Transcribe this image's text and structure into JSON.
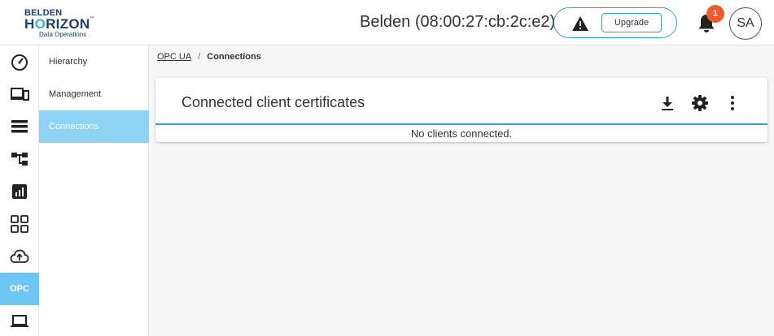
{
  "app": {
    "logo_line1": "BELDEN",
    "logo_line2a": "H",
    "logo_line2o": "O",
    "logo_line2b": "RIZON",
    "logo_tm": "™",
    "logo_line3": "Data Operations"
  },
  "header": {
    "device_title": "Belden (08:00:27:cb:2c:e2)",
    "upgrade_label": "Upgrade",
    "notification_count": "1",
    "avatar_initials": "SA"
  },
  "rail": {
    "items": [
      {
        "icon": "dashboard-gauge-icon"
      },
      {
        "icon": "devices-icon"
      },
      {
        "icon": "list-icon"
      },
      {
        "icon": "hierarchy-tree-icon"
      },
      {
        "icon": "bar-chart-icon"
      },
      {
        "icon": "apps-grid-icon"
      },
      {
        "icon": "cloud-upload-icon"
      },
      {
        "icon": "opc-icon",
        "label": "OPC",
        "active": true
      },
      {
        "icon": "laptop-icon"
      }
    ]
  },
  "subnav": {
    "items": [
      {
        "label": "Hierarchy"
      },
      {
        "label": "Management"
      },
      {
        "label": "Connections",
        "active": true
      }
    ]
  },
  "breadcrumb": {
    "parent": "OPC UA",
    "separator": "/",
    "current": "Connections"
  },
  "card": {
    "title": "Connected client certificates",
    "empty_message": "No clients connected.",
    "tools": [
      "download-icon",
      "settings-gear-icon",
      "more-vertical-icon"
    ]
  },
  "colors": {
    "accent": "#2aa7cf",
    "rail_active": "#6ec7f2",
    "subnav_active": "#8fd3f4",
    "badge": "#f15a2b",
    "brand_navy": "#1c3f6e"
  }
}
